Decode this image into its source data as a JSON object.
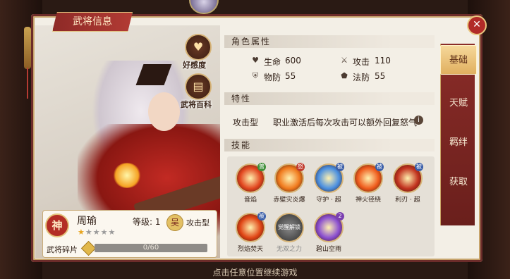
{
  "window": {
    "title": "武将信息"
  },
  "portrait": {
    "affection_label": "好感度",
    "encyclopedia_label": "武将百科"
  },
  "hero": {
    "rank_badge": "神",
    "name": "周瑜",
    "level_text": "等级: 1",
    "faction_badge": "吴",
    "type": "攻击型",
    "stars_filled": 1,
    "stars_total": 5,
    "shard_label": "武将碎片",
    "shard_progress_text": "0/60",
    "shard_progress_fraction": 0
  },
  "attributes": {
    "header": "角色属性",
    "hp_label": "生命",
    "hp_value": "600",
    "atk_label": "攻击",
    "atk_value": "110",
    "def_label": "物防",
    "def_value": "55",
    "mdef_label": "法防",
    "mdef_value": "55"
  },
  "traits": {
    "header": "特性",
    "name": "攻击型",
    "description": "职业激活后每次攻击可以额外回复怒气"
  },
  "skills": {
    "header": "技能",
    "items": [
      {
        "name": "音焰",
        "tag": "普",
        "tag_color": "#3f8f3a",
        "color": "#e2461f",
        "locked": false
      },
      {
        "name": "赤壁灾炎爆",
        "tag": "怒",
        "tag_color": "#c0392b",
        "color": "#f07a1d",
        "locked": false
      },
      {
        "name": "守护 · 超",
        "tag": "被",
        "tag_color": "#3a5ea8",
        "color": "#4a8fe0",
        "locked": false
      },
      {
        "name": "神火径绕",
        "tag": "被",
        "tag_color": "#3a5ea8",
        "color": "#ef5b1c",
        "locked": false
      },
      {
        "name": "利刃 · 超",
        "tag": "被",
        "tag_color": "#3a5ea8",
        "color": "#c2331f",
        "locked": false
      },
      {
        "name": "烈焰焚天",
        "tag": "被",
        "tag_color": "#3a5ea8",
        "color": "#e04515",
        "locked": false
      },
      {
        "name": "无双之力",
        "tag": "",
        "tag_color": "",
        "color": "#555555",
        "locked": true,
        "lock_text": "觉醒解锁"
      },
      {
        "name": "碧山空雨",
        "tag": "2",
        "tag_color": "#7b3fb0",
        "color": "#8b4fd0",
        "locked": false
      }
    ]
  },
  "tabs": [
    "基础",
    "天赋",
    "羁绊",
    "获取"
  ],
  "active_tab_index": 0,
  "footer": {
    "hint": "点击任意位置继续游戏"
  }
}
